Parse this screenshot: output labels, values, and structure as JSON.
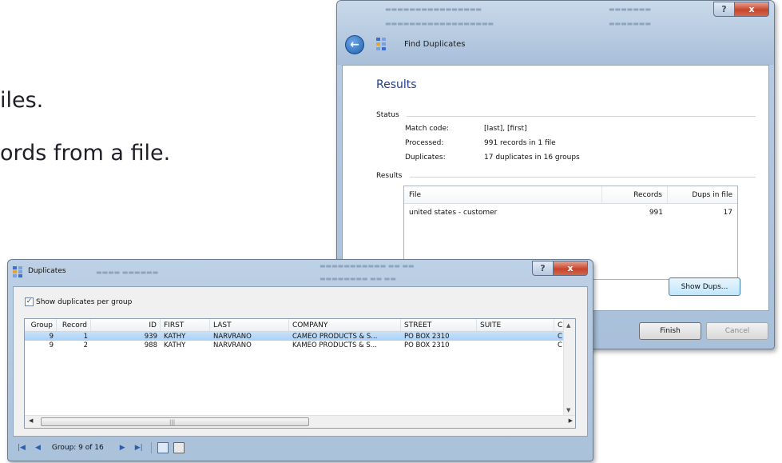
{
  "slide": {
    "line1": "iles.",
    "line2": "ords from a file."
  },
  "find_duplicates": {
    "window_title": "Find Duplicates",
    "help_label": "?",
    "close_label": "x",
    "heading": "Results",
    "status_label": "Status",
    "match_code_label": "Match code:",
    "match_code_value": "[last], [first]",
    "processed_label": "Processed:",
    "processed_value": "991 records in 1 file",
    "duplicates_label": "Duplicates:",
    "duplicates_value": "17 duplicates in 16 groups",
    "results_label": "Results",
    "table": {
      "columns": [
        "File",
        "Records",
        "Dups in file"
      ],
      "rows": [
        {
          "file": "united states - customer",
          "records": "991",
          "dups": "17"
        }
      ]
    },
    "show_dups_label": "Show Dups...",
    "finish_label": "Finish",
    "cancel_label": "Cancel"
  },
  "duplicates": {
    "window_title": "Duplicates",
    "help_label": "?",
    "close_label": "x",
    "checkbox_label": "Show duplicates per group",
    "checkbox_checked": true,
    "columns": [
      "Group",
      "Record",
      "ID",
      "FIRST",
      "LAST",
      "COMPANY",
      "STREET",
      "SUITE",
      "C"
    ],
    "rows": [
      {
        "group": "9",
        "record": "1",
        "id": "939",
        "first": "KATHY",
        "last": "NARVRANO",
        "company": "CAMEO PRODUCTS & S...",
        "street": "PO BOX 2310",
        "suite": "",
        "c": "C"
      },
      {
        "group": "9",
        "record": "2",
        "id": "988",
        "first": "KATHY",
        "last": "NARVRANO",
        "company": "KAMEO PRODUCTS & S...",
        "street": "PO BOX 2310",
        "suite": "",
        "c": "C"
      }
    ],
    "group_nav": "Group: 9 of 16"
  },
  "colors": {
    "accent": "#1e3f8c",
    "selection": "#a9d1f7",
    "close_button": "#c6452c"
  },
  "icons": [
    "back-arrow-icon",
    "app-grid-icon",
    "help-icon",
    "close-icon",
    "first-icon",
    "prev-icon",
    "next-icon",
    "last-icon",
    "copy-icon",
    "print-icon"
  ]
}
